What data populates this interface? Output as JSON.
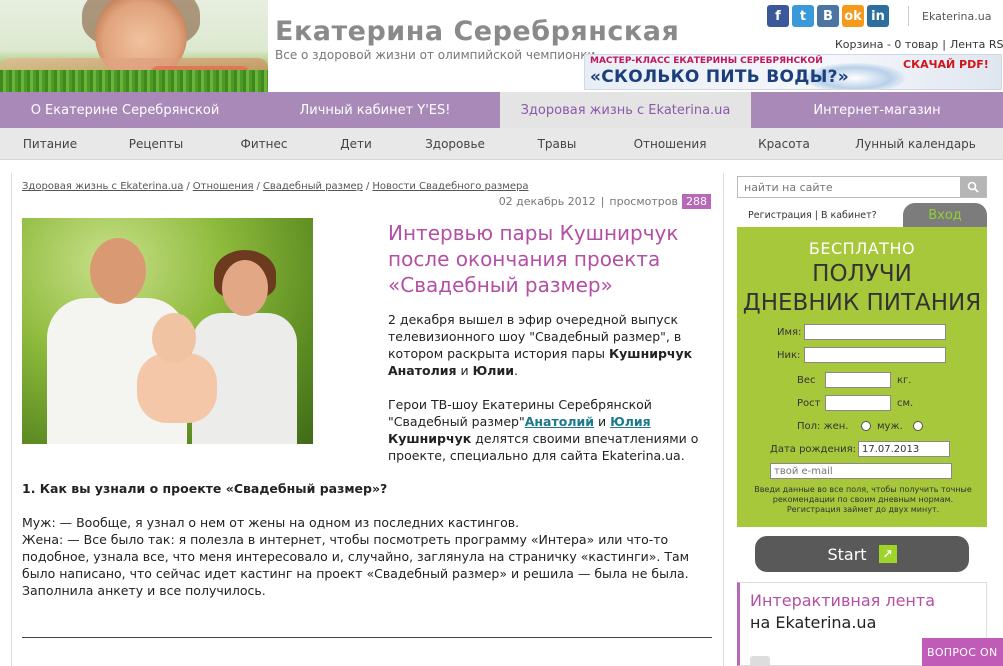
{
  "header": {
    "brand": "Екатерина Серебрянская",
    "tagline": "Все о здоровой жизни от олимпийской чемпионки",
    "social": [
      {
        "icon": "facebook-icon",
        "glyph": "f"
      },
      {
        "icon": "twitter-icon",
        "glyph": "t"
      },
      {
        "icon": "vkontakte-icon",
        "glyph": "B"
      },
      {
        "icon": "odnoklassniki-icon",
        "glyph": "ok"
      },
      {
        "icon": "linkedin-icon",
        "glyph": "in"
      }
    ],
    "site_link": "Ekaterina.ua",
    "cart": "Корзина - 0 товар",
    "rss": "Лента RSS",
    "banner": {
      "small": "МАСТЕР-КЛАСС ЕКАТЕРИНЫ СЕРЕБРЯНСКОЙ",
      "big": "«СКОЛЬКО ПИТЬ ВОДЫ?»",
      "pdf": "СКАЧАЙ PDF!"
    }
  },
  "nav_primary": [
    {
      "label": "О Екатерине Серебрянской",
      "active": false
    },
    {
      "label": "Личный кабинет Y'ES!",
      "active": false
    },
    {
      "label": "Здоровая жизнь с Ekaterina.ua",
      "active": true
    },
    {
      "label": "Интернет-магазин",
      "active": false
    }
  ],
  "nav_secondary": [
    "Питание",
    "Рецепты",
    "Фитнес",
    "Дети",
    "Здоровье",
    "Травы",
    "Отношения",
    "Красота",
    "Лунный календарь"
  ],
  "breadcrumbs": [
    "Здоровая жизнь с Ekaterina.ua",
    "Отношения",
    "Свадебный размер",
    "Новости Свадебного размера"
  ],
  "article": {
    "date": "02 декабрь 2012",
    "views_label": "просмотров",
    "views": "288",
    "title": "Интервью пары Кушнирчук после окончания проекта «Свадебный размер»",
    "p1_pre": "2 декабря вышел в эфир очередной выпуск телевизионного шоу \"Свадебный размер\", в котором раскрыта история пары ",
    "p1_bold": "Кушнирчук Анатолия",
    "p1_mid": " и ",
    "p1_bold2": "Юлии",
    "p1_end": ".",
    "p2_pre": "Герои ТВ-шоу Екатерины Серебрянской \"Свадебный размер\"",
    "link1": "Анатолий",
    "p2_and": " и ",
    "link2": "Юлия",
    "p2_bold": " Кушнирчук",
    "p2_end": " делятся своими впечатлениями о проекте, специально для сайта Ekaterina.ua.",
    "question": "1. Как вы узнали о проекте «Свадебный размер»?",
    "answer_husband": "Муж: — Вообще, я узнал о нем от жены на одном из последних кастингов.",
    "answer_wife": "Жена: — Все было так: я полезла в интернет, чтобы посмотреть программу «Интера» или что-то подобное, узнала все, что меня интересовало и, случайно, заглянула на страничку «кастинги». Там было написано, что сейчас идет кастинг на проект «Свадебный размер» и решила — была не была. Заполнила анкету и все получилось."
  },
  "sidebar": {
    "search_placeholder": "найти на сайте",
    "register": "Регистрация | В кабинет?",
    "login": "Вход",
    "promo": {
      "free": "БЕСПЛАТНО",
      "get": "ПОЛУЧИ",
      "diary": "ДНЕВНИК ПИТАНИЯ",
      "name_label": "Имя:",
      "nick_label": "Ник:",
      "weight_label": "Вес",
      "weight_unit": "кг.",
      "height_label": "Рост",
      "height_unit": "см.",
      "gender_label": "Пол: жен.",
      "gender_male": "муж.",
      "birth_label": "Дата рождения:",
      "birth_value": "17.07.2013",
      "email_placeholder": "твой e-mail",
      "note": "Введи данные во все поля, чтобы получить точные рекомендации по своим дневным нормам. Регистрация займет до двух минут."
    },
    "start": "Start",
    "feed_title": "Интерактивная лента",
    "feed_sub": "на Ekaterina.ua",
    "question_tab": "ВОПРОС ON"
  },
  "colors": {
    "nav_primary": "#a989b8",
    "accent": "#b34fa4",
    "promo_green": "#a8c83c"
  }
}
